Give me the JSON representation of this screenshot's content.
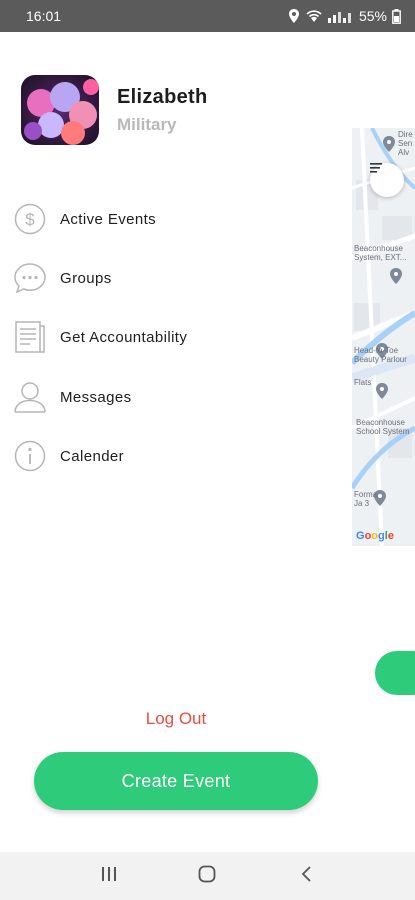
{
  "status_bar": {
    "time": "16:01",
    "battery": "55%",
    "icons": [
      "location-icon",
      "wifi-icon",
      "signal-icon",
      "battery-icon"
    ]
  },
  "profile": {
    "name": "Elizabeth",
    "role": "Military"
  },
  "menu": [
    {
      "label": "Active Events",
      "icon": "dollar-circle-icon"
    },
    {
      "label": "Groups",
      "icon": "chat-bubble-icon"
    },
    {
      "label": "Get Accountability",
      "icon": "document-icon"
    },
    {
      "label": "Messages",
      "icon": "user-icon"
    },
    {
      "label": "Calender",
      "icon": "info-icon"
    }
  ],
  "actions": {
    "logout_label": "Log Out",
    "create_event_label": "Create Event"
  },
  "map": {
    "labels": {
      "top": "Dire\nSen\nAlv",
      "l1": "Beaconhouse\nSystem, EXT...",
      "l2": "Head-to-Toe\nBeauty Parlour",
      "l3": "Flats",
      "l4": "Beaconhouse\nSchool System",
      "l5": "Forma\nJa 3"
    },
    "google": "Google"
  },
  "colors": {
    "accent": "#2ecc7a",
    "logout": "#e74c3c",
    "status_bar": "#5b5b5b"
  }
}
